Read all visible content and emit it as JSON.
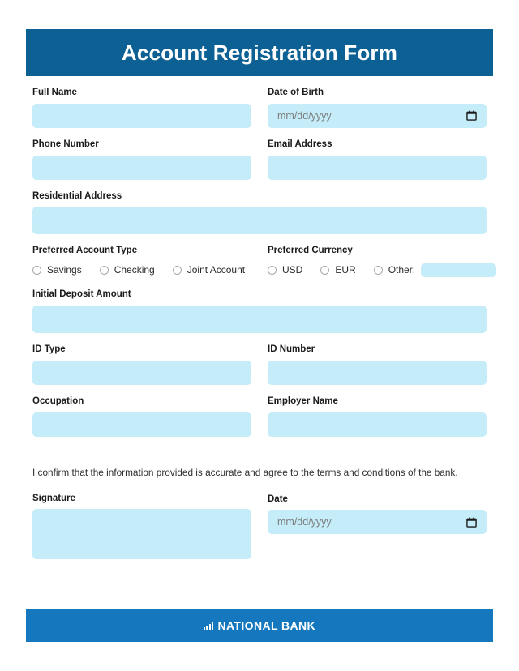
{
  "header": {
    "title": "Account Registration Form",
    "background_color": "#0c6094"
  },
  "theme": {
    "field_fill": "#c5ecf9",
    "header_blue": "#0c6094",
    "footer_blue": "#1578be",
    "page_background": "#ffffff",
    "label_color": "#1b1b1b"
  },
  "form": {
    "fields": {
      "full_name": {
        "label": "Full Name",
        "value": "",
        "placeholder": ""
      },
      "date_of_birth": {
        "label": "Date of Birth",
        "value": "",
        "placeholder": "mm/dd/yyyy",
        "icon": "calendar-icon"
      },
      "phone_number": {
        "label": "Phone Number",
        "value": "",
        "placeholder": ""
      },
      "email_address": {
        "label": "Email Address",
        "value": "",
        "placeholder": ""
      },
      "residential_address": {
        "label": "Residential Address",
        "value": "",
        "placeholder": ""
      },
      "initial_deposit_amount": {
        "label": "Initial Deposit Amount",
        "value": "",
        "placeholder": ""
      },
      "id_type": {
        "label": "ID Type",
        "value": "",
        "placeholder": ""
      },
      "id_number": {
        "label": "ID Number",
        "value": "",
        "placeholder": ""
      },
      "occupation": {
        "label": "Occupation",
        "value": "",
        "placeholder": ""
      },
      "employer_name": {
        "label": "Employer Name",
        "value": "",
        "placeholder": ""
      },
      "signature": {
        "label": "Signature",
        "value": "",
        "placeholder": ""
      },
      "date": {
        "label": "Date",
        "value": "",
        "placeholder": "mm/dd/yyyy",
        "icon": "calendar-icon"
      }
    },
    "account_type": {
      "label": "Preferred Account Type",
      "options": [
        {
          "label": "Savings",
          "selected": false
        },
        {
          "label": "Checking",
          "selected": false
        },
        {
          "label": "Joint Account",
          "selected": false
        }
      ]
    },
    "currency": {
      "label": "Preferred Currency",
      "options": [
        {
          "label": "USD",
          "selected": false
        },
        {
          "label": "EUR",
          "selected": false
        },
        {
          "label": "Other:",
          "selected": false,
          "has_input": true,
          "input_value": ""
        }
      ]
    },
    "confirmation_text": "I confirm that the information provided is accurate and agree to the terms and conditions of the bank."
  },
  "footer": {
    "logo_text": "NATIONAL BANK",
    "logo_icon": "bar-chart-icon",
    "background_color": "#1578be"
  }
}
